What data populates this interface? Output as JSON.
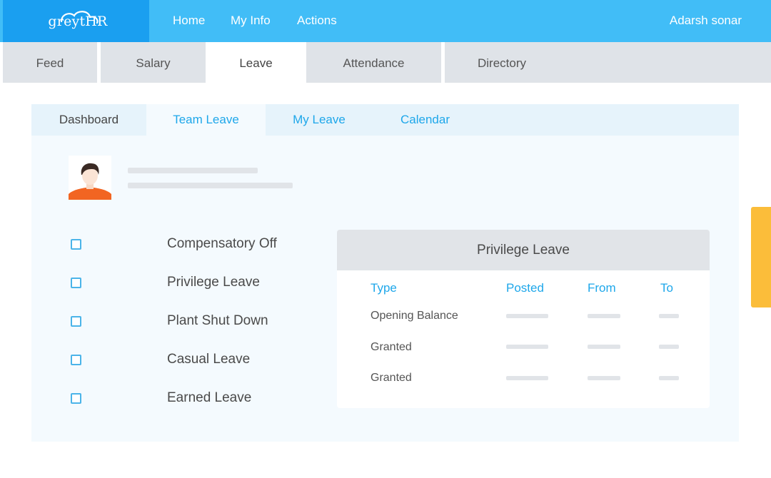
{
  "brand": {
    "logo_text": "greytHR"
  },
  "topnav": {
    "items": [
      "Home",
      "My Info",
      "Actions"
    ],
    "user_name": "Adarsh sonar"
  },
  "main_tabs": {
    "items": [
      "Feed",
      "Salary",
      "Leave",
      "Attendance",
      "Directory"
    ],
    "active": "Leave"
  },
  "sub_tabs": {
    "items": [
      "Dashboard",
      "Team Leave",
      "My Leave",
      "Calendar"
    ],
    "active": "Team Leave"
  },
  "leave_types": [
    "Compensatory Off",
    "Privilege Leave",
    "Plant Shut Down",
    "Casual Leave",
    "Earned Leave"
  ],
  "detail_card": {
    "title": "Privilege Leave",
    "columns": [
      "Type",
      "Posted",
      "From",
      "To"
    ],
    "rows": [
      "Opening Balance",
      "Granted",
      "Granted"
    ]
  },
  "colors": {
    "header_blue": "#41bdf7",
    "logo_blue": "#1a9ff0",
    "link_blue": "#1ea7ea",
    "accent_yellow": "#fbbd3a",
    "avatar_shirt": "#f26522"
  }
}
